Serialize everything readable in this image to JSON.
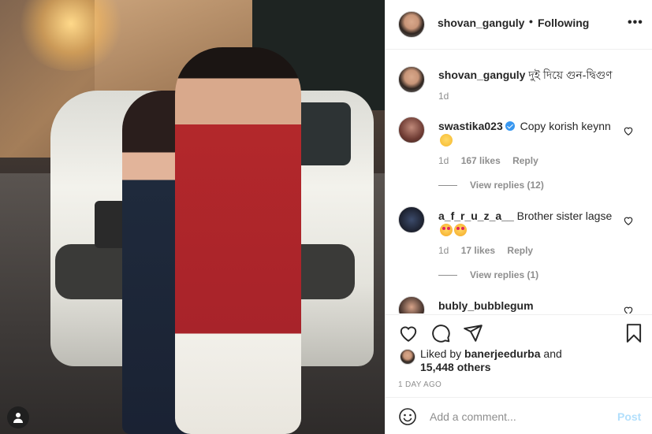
{
  "post": {
    "author": "shovan_ganguly",
    "follow_status": "Following",
    "dot": "•",
    "more": "•••"
  },
  "caption": {
    "username": "shovan_ganguly",
    "text": "দুই দিয়ে গুন-দ্বিগুণ",
    "time": "1d"
  },
  "comments": [
    {
      "username": "swastika023",
      "verified": true,
      "text": "Copy korish keynn",
      "emoji": "smirk-emoji",
      "time": "1d",
      "likes": "167 likes",
      "reply": "Reply",
      "replies": "View replies (12)"
    },
    {
      "username": "a_f_r_u_z_a__",
      "verified": false,
      "text": "Brother sister lagse",
      "emoji": "heart-eyes-emoji",
      "time": "1d",
      "likes": "17 likes",
      "reply": "Reply",
      "replies": "View replies (1)"
    },
    {
      "username": "bubly_bubblegum",
      "verified": false
    }
  ],
  "actions": {
    "liked_by_prefix": "Liked by",
    "liked_by_user": "banerjeedurba",
    "liked_by_and": "and",
    "others": "15,448 others",
    "ago": "1 DAY AGO"
  },
  "add_comment": {
    "placeholder": "Add a comment...",
    "post_label": "Post"
  },
  "icons": [
    "user-tag-icon",
    "heart-icon",
    "comment-icon",
    "share-icon",
    "bookmark-icon",
    "smile-icon",
    "verified-icon"
  ],
  "colors": {
    "text": "#262626",
    "muted": "#8e8e8e",
    "verified": "#3897f0",
    "post_disabled": "#b2dffc",
    "border": "#efefef"
  }
}
